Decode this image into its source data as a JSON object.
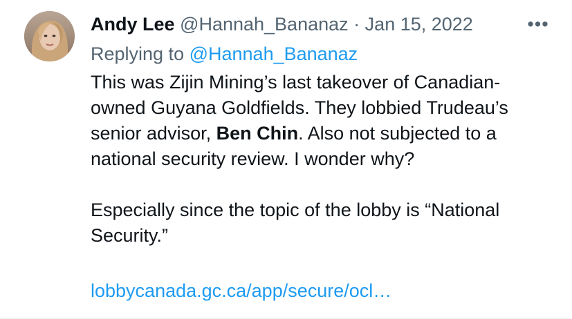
{
  "author": {
    "name": "Andy Lee",
    "handle": "@Hannah_Bananaz",
    "separator": "·",
    "date": "Jan 15, 2022"
  },
  "more_label": "•••",
  "reply": {
    "prefix": "Replying to ",
    "target": "@Hannah_Bananaz"
  },
  "body": {
    "p1_a": "This was Zijin Mining’s last takeover of Canadian-owned Guyana Goldfields. They lobbied Trudeau’s senior advisor, ",
    "p1_bold": "Ben Chin",
    "p1_b": ". Also not subjected to a national security review. I wonder why?",
    "p2": "Especially since the topic of the lobby is “National Security.”"
  },
  "link_text": "lobbycanada.gc.ca/app/secure/ocl…",
  "colors": {
    "text": "#0f1419",
    "secondary": "#536471",
    "link": "#1d9bf0"
  }
}
